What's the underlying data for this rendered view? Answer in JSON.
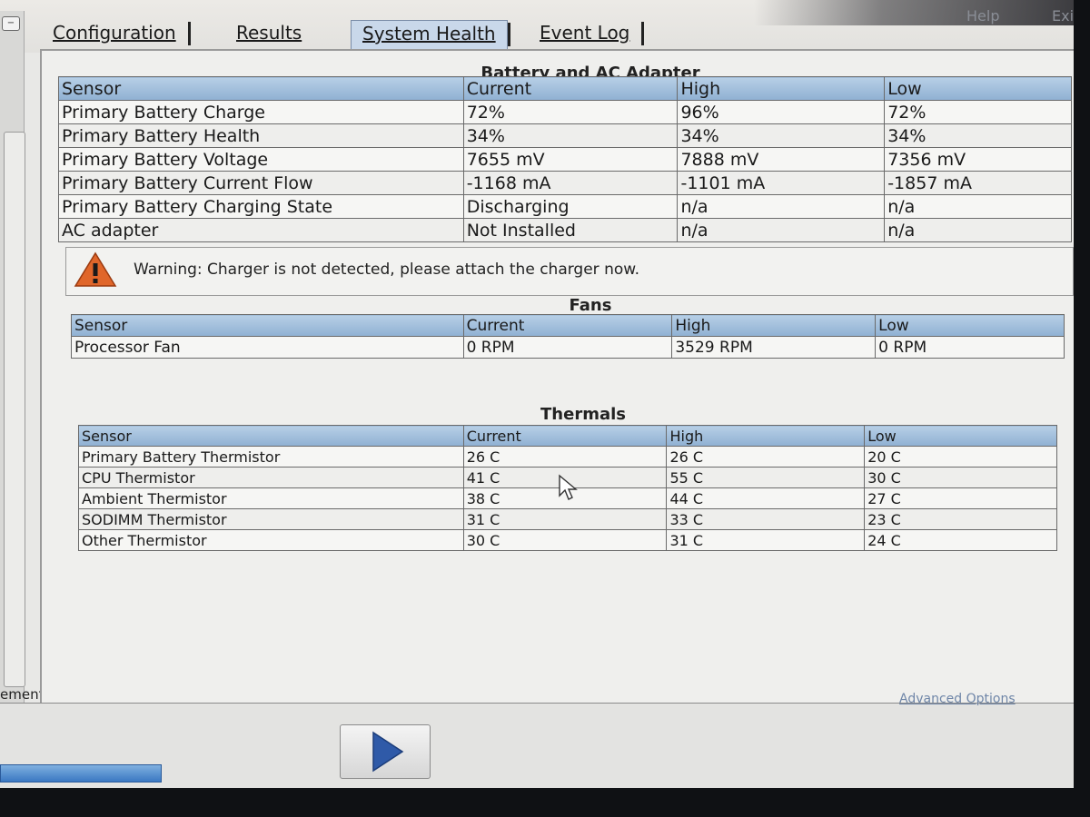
{
  "top_links": {
    "help": "Help",
    "exit": "Exit"
  },
  "tabs": [
    {
      "label": "Configuration"
    },
    {
      "label": "Results"
    },
    {
      "label": "System Health"
    },
    {
      "label": "Event Log"
    }
  ],
  "active_tab": "System Health",
  "battery": {
    "title": "Battery and AC Adapter",
    "columns": [
      "Sensor",
      "Current",
      "High",
      "Low"
    ],
    "rows": [
      [
        "Primary Battery Charge",
        "72%",
        "96%",
        "72%"
      ],
      [
        "Primary Battery Health",
        "34%",
        "34%",
        "34%"
      ],
      [
        "Primary Battery Voltage",
        "7655 mV",
        "7888 mV",
        "7356 mV"
      ],
      [
        "Primary Battery Current Flow",
        "-1168 mA",
        "-1101 mA",
        "-1857 mA"
      ],
      [
        "Primary Battery Charging State",
        "Discharging",
        "n/a",
        "n/a"
      ],
      [
        "AC adapter",
        "Not Installed",
        "n/a",
        "n/a"
      ]
    ]
  },
  "warning": {
    "icon": "warning-icon",
    "text": "Warning: Charger is not detected, please attach the charger now."
  },
  "fans": {
    "title": "Fans",
    "columns": [
      "Sensor",
      "Current",
      "High",
      "Low"
    ],
    "rows": [
      [
        "Processor Fan",
        "0 RPM",
        "3529 RPM",
        "0 RPM"
      ]
    ]
  },
  "thermals": {
    "title": "Thermals",
    "columns": [
      "Sensor",
      "Current",
      "High",
      "Low"
    ],
    "rows": [
      [
        "Primary Battery Thermistor",
        "26 C",
        "26 C",
        "20 C"
      ],
      [
        "CPU Thermistor",
        "41 C",
        "55 C",
        "30 C"
      ],
      [
        "Ambient Thermistor",
        "38 C",
        "44 C",
        "27 C"
      ],
      [
        "SODIMM Thermistor",
        "31 C",
        "33 C",
        "23 C"
      ],
      [
        "Other Thermistor",
        "30 C",
        "31 C",
        "24 C"
      ]
    ]
  },
  "side_label": "ement",
  "advanced_options": "Advanced Options",
  "colors": {
    "header_blue": "#9fbcd9",
    "warning_orange": "#e0662a",
    "play_blue": "#2f5aa8",
    "progress_blue": "#3a78c2"
  }
}
